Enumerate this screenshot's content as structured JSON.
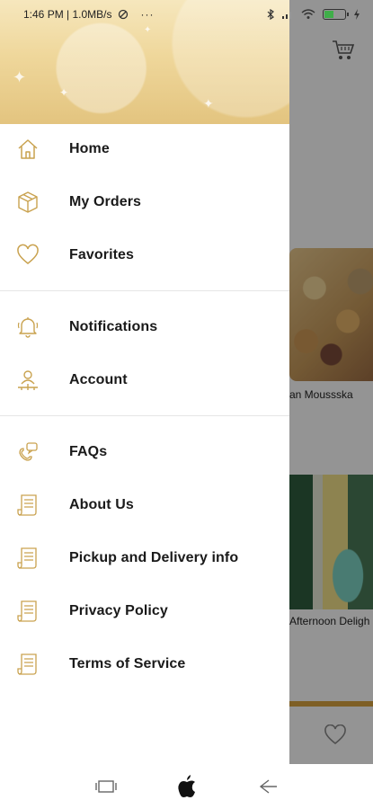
{
  "status_bar": {
    "time_info": "1:46 PM | 1.0MB/s",
    "more": "···",
    "battery_icon": "battery-icon",
    "wifi_icon": "wifi-icon",
    "signal_icon": "signal-icon",
    "bluetooth_icon": "bluetooth-icon"
  },
  "drawer": {
    "header_accent": "#e3c47f",
    "groups": [
      {
        "items": [
          {
            "label": "Home",
            "icon": "home-icon"
          },
          {
            "label": "My Orders",
            "icon": "box-icon"
          },
          {
            "label": "Favorites",
            "icon": "heart-icon"
          }
        ]
      },
      {
        "items": [
          {
            "label": "Notifications",
            "icon": "bell-icon"
          },
          {
            "label": "Account",
            "icon": "account-icon"
          }
        ]
      },
      {
        "items": [
          {
            "label": "FAQs",
            "icon": "chat-icon"
          },
          {
            "label": "About Us",
            "icon": "document-icon"
          },
          {
            "label": "Pickup and Delivery info",
            "icon": "document-icon"
          },
          {
            "label": "Privacy Policy",
            "icon": "document-icon"
          },
          {
            "label": "Terms of Service",
            "icon": "document-icon"
          }
        ]
      }
    ]
  },
  "background_content": {
    "products": [
      {
        "title": "an Moussska"
      },
      {
        "title": "Afternoon Deligh"
      }
    ]
  },
  "colors": {
    "icon_gold": "#c9a24f",
    "scrim": "rgba(0,0,0,0.42)"
  }
}
